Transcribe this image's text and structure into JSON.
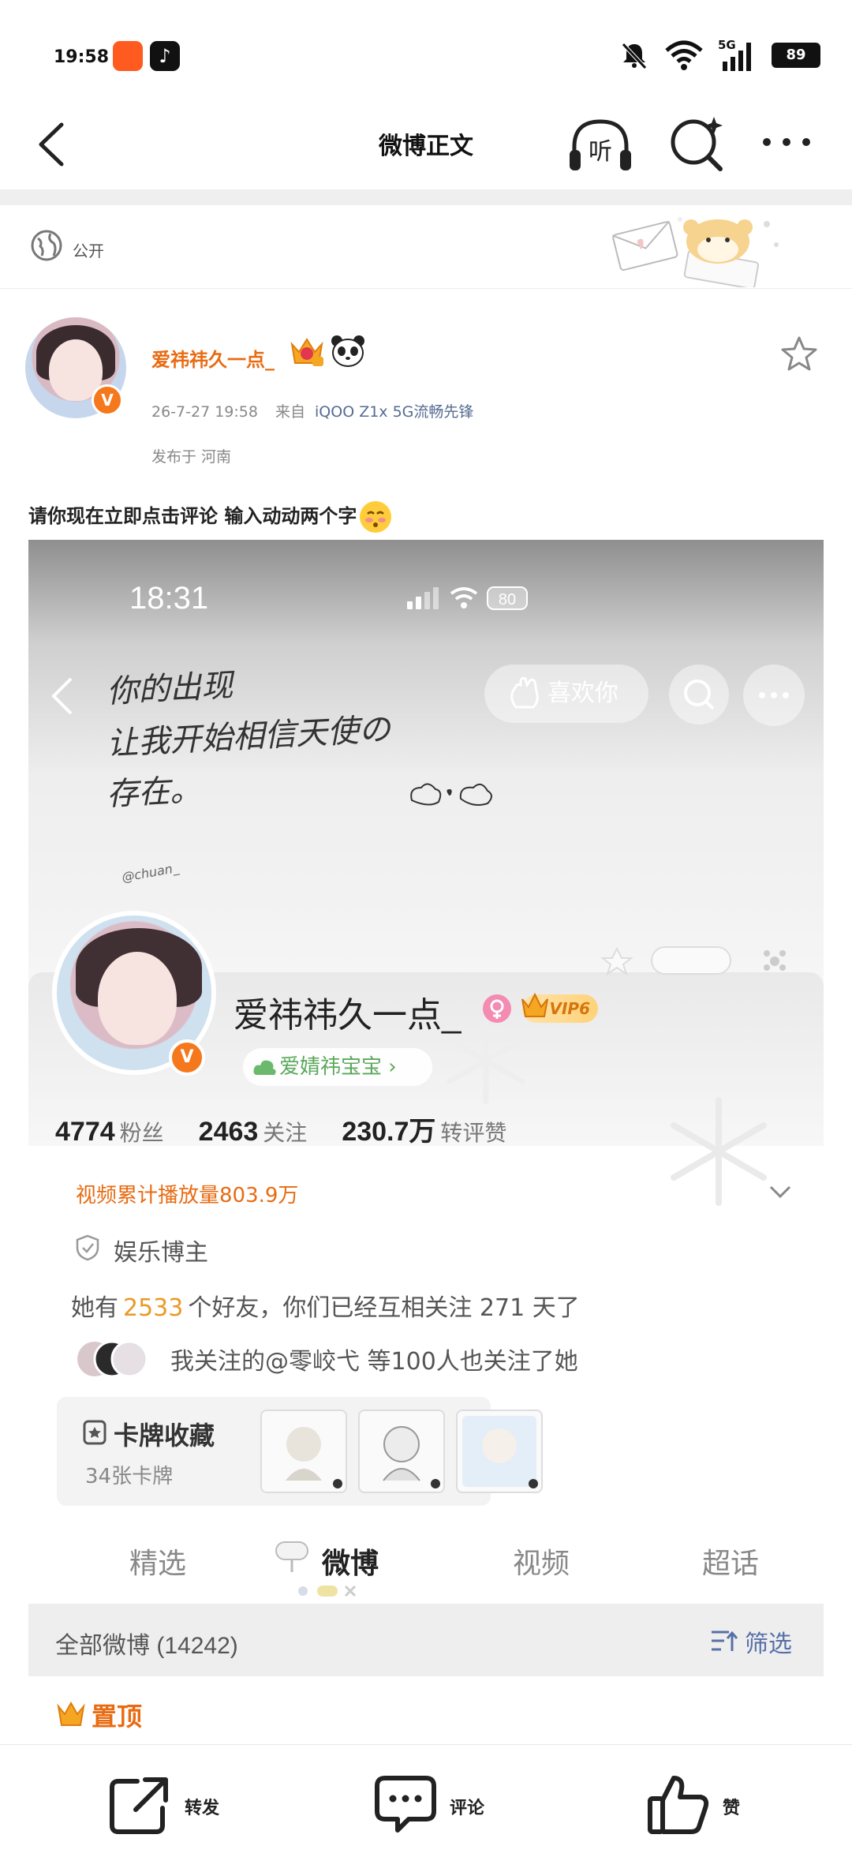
{
  "status_bar": {
    "time": "19:58",
    "network": "5G",
    "battery": "89"
  },
  "nav": {
    "title": "微博正文",
    "listen_label": "听"
  },
  "visibility": {
    "label": "公开"
  },
  "post": {
    "username": "爱祎祎久一点_",
    "timestamp": "26-7-27 19:58",
    "source_label": "来自",
    "source_device": "iQOO Z1x 5G流畅先锋",
    "location": "发布于 河南",
    "text": "请你现在立即点击评论 输入动动两个字"
  },
  "embedded_screenshot": {
    "time": "18:31",
    "battery": "80",
    "like_button": "喜欢你",
    "handwriting": [
      "你的出现",
      "让我开始相信天使の",
      "存在。"
    ],
    "handle": "@chuan_",
    "profile": {
      "name": "爱祎祎久一点_",
      "vip_label": "VIP6",
      "fan_group": "爱婧祎宝宝 ›",
      "stats": [
        {
          "value": "4774",
          "label": "粉丝"
        },
        {
          "value": "2463",
          "label": "关注"
        },
        {
          "value": "230.7万",
          "label": "转评赞"
        }
      ],
      "video_plays": "视频累计播放量803.9万",
      "role": "娱乐博主",
      "friends_prefix": "她有",
      "friends_count": "2533",
      "friends_suffix": "个好友，你们已经互相关注 271 天了",
      "mutual_follow": "我关注的@零峧弋 等100人也关注了她",
      "cards_title": "卡牌收藏",
      "cards_count": "34张卡牌",
      "tabs": [
        "精选",
        "微博",
        "视频",
        "超话"
      ],
      "active_tab": "微博",
      "all_posts": "全部微博 (14242)",
      "filter": "筛选",
      "pinned": "置顶"
    }
  },
  "actions": {
    "repost": "转发",
    "comment": "评论",
    "like": "赞"
  },
  "colors": {
    "accent_orange": "#e86b12",
    "link_blue": "#556c91",
    "fan_green": "#5aa85b"
  }
}
